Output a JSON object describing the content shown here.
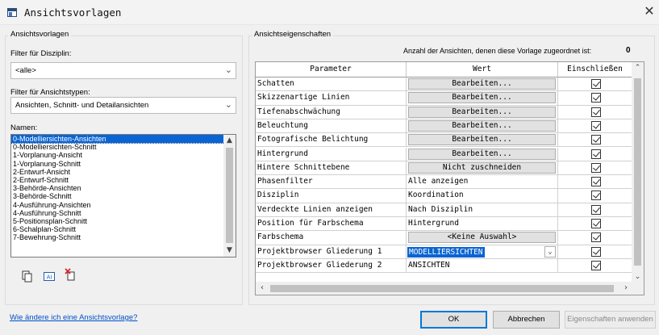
{
  "window": {
    "title": "Ansichtsvorlagen",
    "close_glyph": "✕"
  },
  "left": {
    "group_title": "Ansichtsvorlagen",
    "discipline_filter_label": "Filter für Disziplin:",
    "discipline_filter_value": "<alle>",
    "viewtype_filter_label": "Filter für Ansichtstypen:",
    "viewtype_filter_value": "Ansichten, Schnitt- und Detailansichten",
    "names_label": "Namen:",
    "names": [
      "0-Modelliersichten-Ansichten",
      "0-Modelliersichten-Schnitt",
      "1-Vorplanung-Ansicht",
      "1-Vorplanung-Schnitt",
      "2-Entwurf-Ansicht",
      "2-Entwurf-Schnitt",
      "3-Behörde-Ansichten",
      "3-Behörde-Schnitt",
      "4-Ausführung-Ansichten",
      "4-Ausführung-Schnitt",
      "5-Positionsplan-Schnitt",
      "6-Schalplan-Schnitt",
      "7-Bewehrung-Schnitt"
    ],
    "selected_index": 0,
    "icons": [
      "duplicate-icon",
      "rename-icon",
      "delete-icon"
    ]
  },
  "right": {
    "group_title": "Ansichtseigenschaften",
    "count_label": "Anzahl der Ansichten, denen diese Vorlage zugeordnet ist:",
    "count_value": "0",
    "columns": [
      "Parameter",
      "Wert",
      "Einschließen"
    ],
    "rows": [
      {
        "parameter": "Schatten",
        "value": "Bearbeiten...",
        "kind": "button",
        "include": true
      },
      {
        "parameter": "Skizzenartige Linien",
        "value": "Bearbeiten...",
        "kind": "button",
        "include": true
      },
      {
        "parameter": "Tiefenabschwächung",
        "value": "Bearbeiten...",
        "kind": "button",
        "include": true
      },
      {
        "parameter": "Beleuchtung",
        "value": "Bearbeiten...",
        "kind": "button",
        "include": true
      },
      {
        "parameter": "Fotografische Belichtung",
        "value": "Bearbeiten...",
        "kind": "button",
        "include": true
      },
      {
        "parameter": "Hintergrund",
        "value": "Bearbeiten...",
        "kind": "button",
        "include": true
      },
      {
        "parameter": "Hintere Schnittebene",
        "value": "Nicht zuschneiden",
        "kind": "button",
        "include": true
      },
      {
        "parameter": "Phasenfilter",
        "value": "Alle anzeigen",
        "kind": "text",
        "include": true
      },
      {
        "parameter": "Disziplin",
        "value": "Koordination",
        "kind": "text",
        "include": true
      },
      {
        "parameter": "Verdeckte Linien anzeigen",
        "value": "Nach Disziplin",
        "kind": "text",
        "include": true
      },
      {
        "parameter": "Position für Farbschema",
        "value": "Hintergrund",
        "kind": "text",
        "include": true
      },
      {
        "parameter": "Farbschema",
        "value": "<Keine Auswahl>",
        "kind": "button",
        "include": true
      },
      {
        "parameter": "Projektbrowser Gliederung 1",
        "value": "MODELLIERSICHTEN",
        "kind": "combo",
        "include": true
      },
      {
        "parameter": "Projektbrowser Gliederung 2",
        "value": "ANSICHTEN",
        "kind": "text",
        "include": true
      }
    ]
  },
  "footer": {
    "help_link": "Wie ändere ich eine Ansichtsvorlage?",
    "ok": "OK",
    "cancel": "Abbrechen",
    "apply": "Eigenschaften anwenden"
  }
}
